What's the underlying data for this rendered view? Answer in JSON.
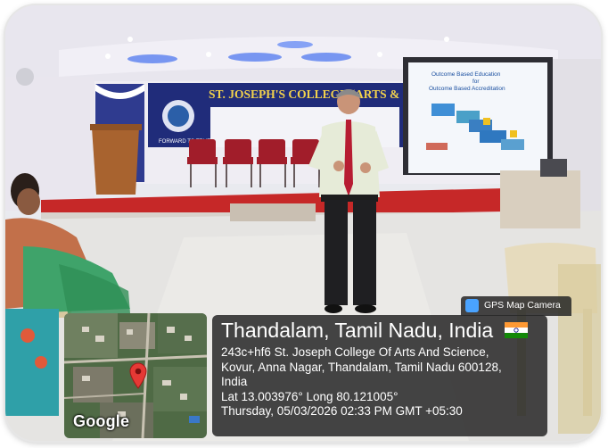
{
  "banner": {
    "college_name": "ST. JOSEPH'S COLLEGE (ARTS & SCIENCE)",
    "motto": "FORWARD TO TRUTH"
  },
  "slide": {
    "title_line1": "Outcome Based Education",
    "title_line2": "for",
    "title_line3": "Outcome Based Accreditation"
  },
  "overlay": {
    "badge": "GPS Map Camera",
    "location_title": "Thandalam, Tamil Nadu, India",
    "address_line1": "243c+hf6 St. Joseph College Of Arts And Science,",
    "address_line2": "Kovur, Anna Nagar, Thandalam, Tamil Nadu 600128,",
    "address_line3": "India",
    "coords": "Lat 13.003976° Long 80.121005°",
    "datetime": "Thursday, 05/03/2026 02:33 PM GMT +05:30",
    "map_brand": "Google",
    "flag_icon": "india-flag-icon",
    "colors": {
      "panel": "#282828",
      "pin": "#e53935"
    }
  }
}
